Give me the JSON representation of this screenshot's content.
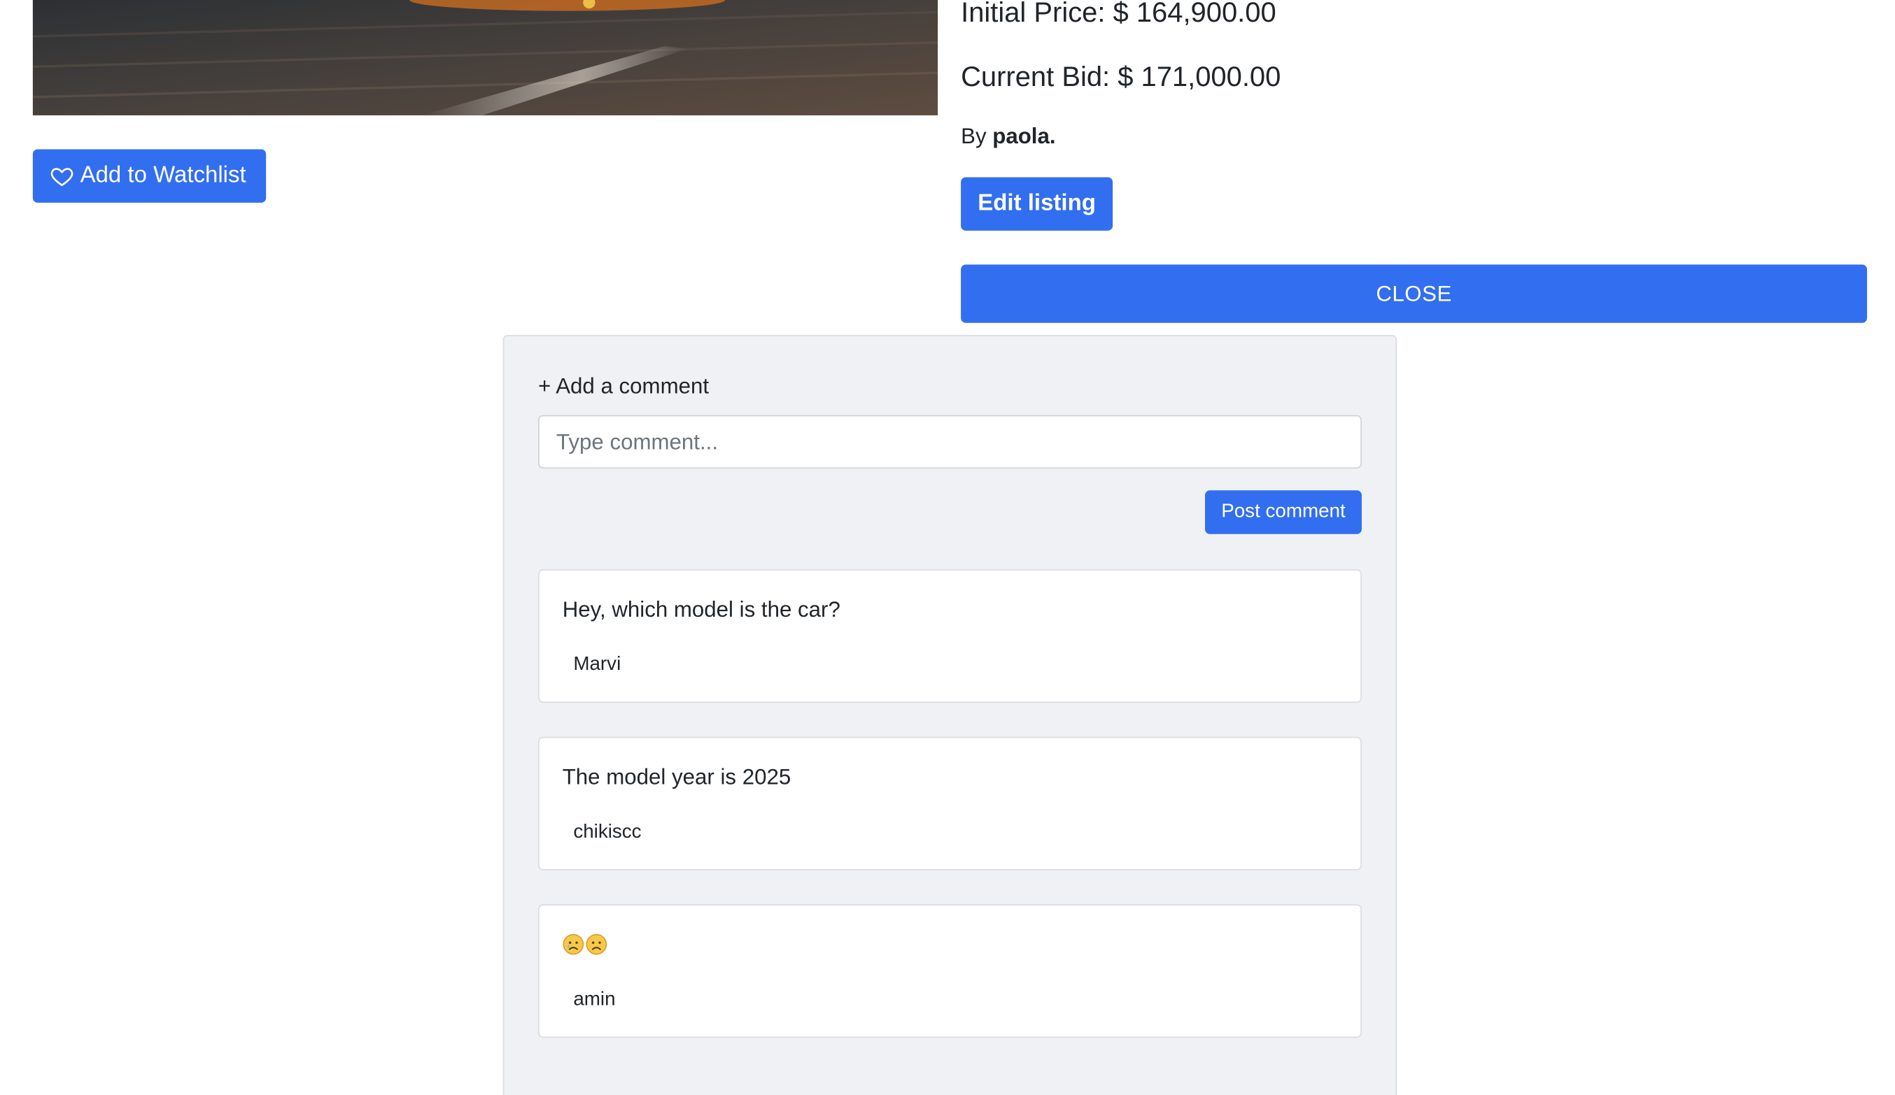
{
  "listing": {
    "image_alt": "car photo",
    "initial_price": "Initial Price: $ 164,900.00",
    "current_bid": "Current Bid: $ 171,000.00",
    "by_prefix": "By ",
    "owner": "paola."
  },
  "actions": {
    "watchlist_label": "Add to Watchlist",
    "edit_label": "Edit listing",
    "close_label": "CLOSE"
  },
  "comments": {
    "add_label": "+ Add a comment",
    "input_placeholder": "Type comment...",
    "input_value": "",
    "post_label": "Post comment",
    "items": [
      {
        "text": "Hey, which model is the car?",
        "author": "Marvi"
      },
      {
        "text": "The model year is 2025",
        "author": "chikiscc"
      },
      {
        "text": "",
        "emoji": [
          "sad-face",
          "sad-face"
        ],
        "author": "amin"
      }
    ]
  },
  "colors": {
    "primary": "#326ef0",
    "panel_bg": "#f0f1f4",
    "card_bg": "#ffffff",
    "text": "#212529"
  }
}
